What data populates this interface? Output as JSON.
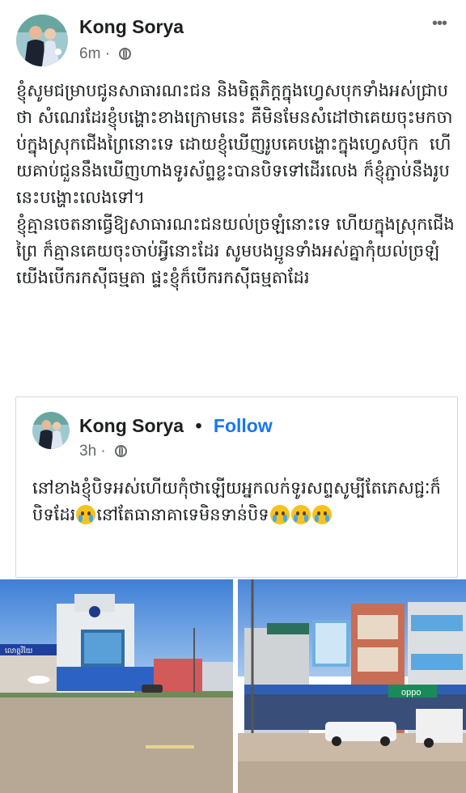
{
  "post": {
    "author": "Kong Sorya",
    "time": "6m",
    "more": "•••",
    "text": "ខ្ញុំសូមជម្រាបជូនសាធារណះជន និងមិត្តភិក្តក្នុងហ្វេសបុកទាំងអស់ជ្រាបថា សំណេរដែរខ្ញុំបង្ហោះខាងក្រោមនេះ គឺមិនមែនសំដៅថាគេយចុះមកចាប់ក្នុងស្រុកជើងព្រៃនោះទេ ដោយខ្ញុំឃើញរូបគេបង្ហោះក្នុងហ្វេសប៊ុក  ហើយគាប់ជួននឹងឃើញហាងទូរស័ព្ទខ្លះបានបិទទៅដើរលេង ក៏ខ្ញុំភ្ជាប់នឹងរូបនេះបង្ហោះលេងទៅ។\nខ្ញុំគ្មានចេតនាធ្វើឱ្យសាធារណះជនយល់ច្រឡំនោះទេ ហើយក្នុងស្រុកជើងព្រៃ ក៏គ្មានគេយចុះចាប់អ្វីនោះដែរ សូមបងប្អូនទាំងអស់គ្នាកុំយល់ច្រឡំ យើងបើករកស៊ីធម្មតា ផ្ទះខ្ញុំក៏បើករកស៊ីធម្មតាដែរ"
  },
  "shared": {
    "author": "Kong Sorya",
    "separator": "•",
    "follow": "Follow",
    "time": "3h",
    "text_part1": "នៅខាងខ្ញុំបិទអស់ហើយកុំថាឡើយអ្នកលក់ទូរសព្ទសូម្បីតែភេសជ្ជៈក៏បិទដែរ",
    "text_part2": "នៅតែធានាគាទេមិនទាន់បិទ"
  },
  "photos": {
    "left_sign": "លោត្តរីយែ",
    "right_sign": "oppo",
    "icons": [
      "avatar-photo",
      "globe-icon",
      "more-icon",
      "crying-emoji-icon"
    ]
  }
}
